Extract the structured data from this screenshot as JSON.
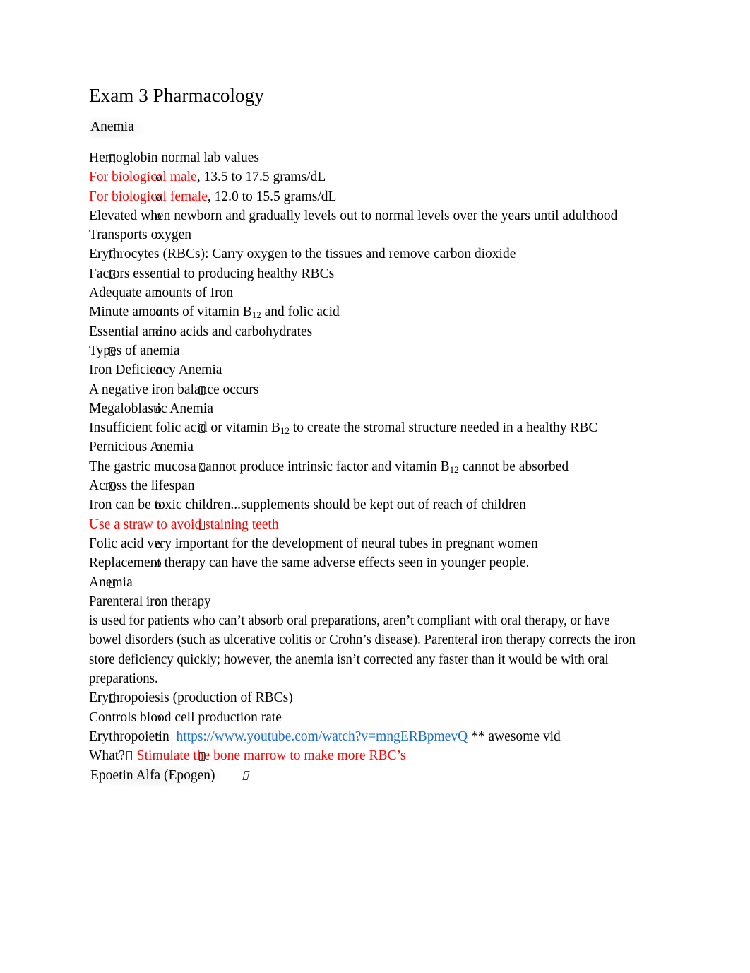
{
  "document": {
    "title": "Exam 3 Pharmacology",
    "subheading": "Anemia"
  },
  "colors": {
    "red": "#FF0000",
    "link_blue": "#1F6FC4",
    "text": "#000000"
  },
  "bullets": {
    "level1_glyph": "tofu-box",
    "level2_glyph": "o",
    "level3_glyph": "tofu-box",
    "level4_glyph": "tofu-box-italic"
  },
  "outline": {
    "hemoglobin": {
      "heading": "Hemoglobin normal lab values",
      "male_label": "For biological male",
      "male_value": ", 13.5 to 17.5 grams/dL",
      "female_label": "For biological female",
      "female_value": ", 12.0 to 15.5 grams/dL",
      "newborn": "Elevated when newborn and gradually levels out to normal levels over the years until adulthood",
      "transports": "Transports oxygen"
    },
    "erythrocytes": "Erythrocytes (RBCs): Carry oxygen to the tissues and remove carbon dioxide",
    "factors": {
      "heading": "Factors essential to producing healthy RBCs",
      "iron": "Adequate amounts of Iron",
      "vitamin_pre": "Minute amounts of vitamin B",
      "vitamin_sub": "12",
      "vitamin_post": " and folic acid",
      "amino": "Essential amino acids and carbohydrates"
    },
    "types": {
      "heading": "Types of anemia",
      "iron_deficiency": "Iron Deficiency Anemia",
      "iron_deficiency_detail": "A negative iron balance occurs",
      "megaloblastic": "Megaloblastic Anemia",
      "megaloblastic_pre": "Insufficient folic acid or vitamin B",
      "megaloblastic_sub": "12",
      "megaloblastic_post": " to create the stromal structure needed in a healthy RBC",
      "pernicious": "Pernicious Anemia",
      "pernicious_pre": "The gastric mucosa cannot produce intrinsic factor and vitamin B",
      "pernicious_sub": "12",
      "pernicious_post": " cannot be absorbed"
    },
    "lifespan": {
      "heading": "Across the lifespan",
      "toxic": "Iron can be toxic children...supplements should be kept out of reach of children",
      "straw": "Use a straw to avoid staining teeth",
      "folic": "Folic acid very important for the development of neural tubes in pregnant women",
      "replacement": "Replacement therapy can have the same adverse effects seen in younger people."
    },
    "anemia": {
      "heading": "Anemia",
      "parenteral_label": "Parenteral iron therapy",
      "parenteral_body": "is used for patients who can’t absorb oral preparations, aren’t compliant with oral therapy, or have bowel disorders (such as ulcerative colitis or Crohn’s disease). Parenteral iron therapy corrects the iron store deficiency quickly; however, the anemia isn’t corrected any faster than it would be with oral preparations."
    },
    "erythropoiesis": {
      "heading": "Erythropoiesis (production of RBCs)",
      "controls": "Controls blood cell production rate",
      "erythropoietin_label": "Erythropoietin",
      "erythropoietin_url": "https://www.youtube.com/watch?v=mngERBpmevQ",
      "erythropoietin_note": "**",
      "erythropoietin_note2": "awesome vid",
      "what_label": "What?",
      "what_answer": "Stimulate the bone marrow to make more RBC’s",
      "epogen": "Epoetin Alfa (Epogen)"
    }
  }
}
